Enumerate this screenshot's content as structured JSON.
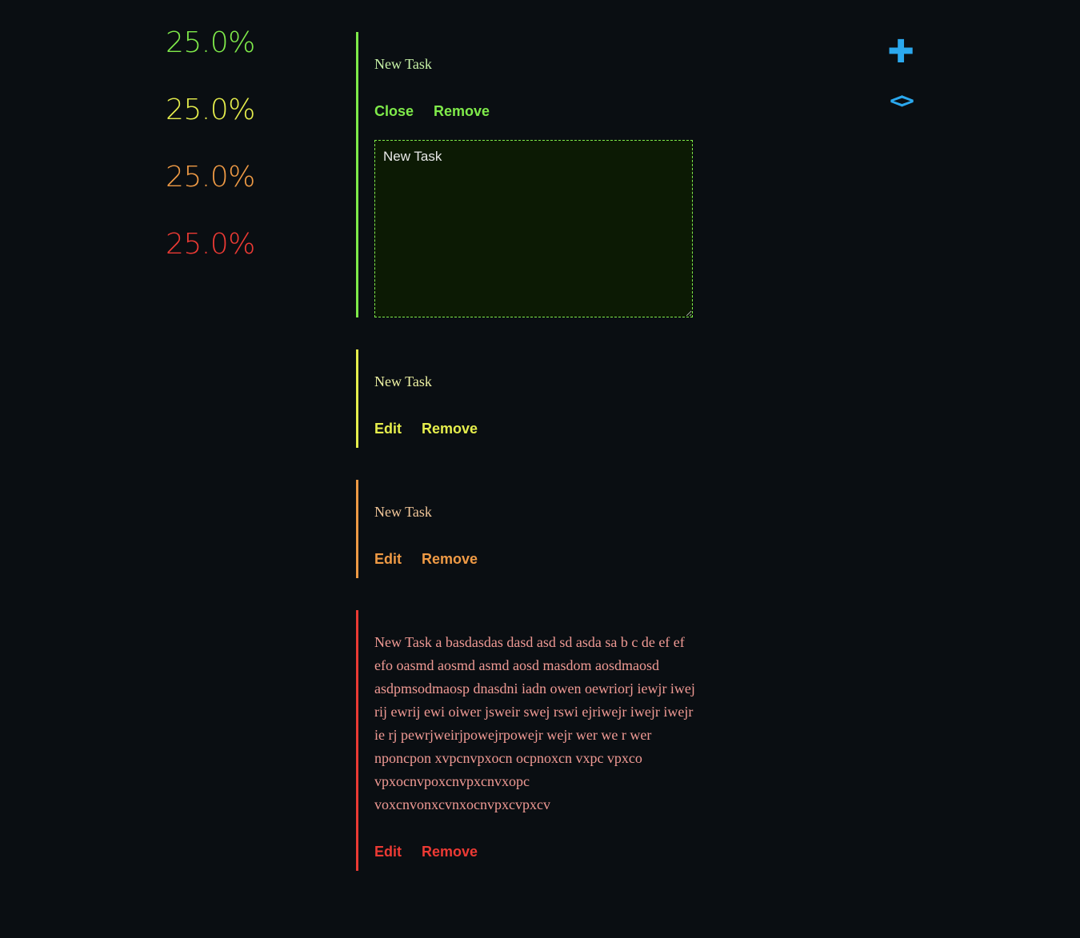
{
  "colors": {
    "background": "#0a0e12",
    "green": "#7fea4a",
    "yellow": "#e6ee4c",
    "orange": "#ef9a45",
    "red": "#ec3a34",
    "accent_blue": "#2ba8ee",
    "editor_bg": "#0c1a04"
  },
  "stats": [
    {
      "value": "25.0%",
      "color": "#7fea4a"
    },
    {
      "value": "25.0%",
      "color": "#e6ee4c"
    },
    {
      "value": "25.0%",
      "color": "#ef9a45"
    },
    {
      "value": "25.0%",
      "color": "#ec3a34"
    }
  ],
  "tasks": [
    {
      "text": "New Task",
      "border_color": "#7fea4a",
      "text_color": "#c8f3a8",
      "action_color": "#7fea4a",
      "editing": true,
      "primary_action": "Close",
      "secondary_action": "Remove",
      "editor_value": "New Task"
    },
    {
      "text": "New Task",
      "border_color": "#e6ee4c",
      "text_color": "#eef2a4",
      "action_color": "#e6ee4c",
      "primary_action": "Edit",
      "secondary_action": "Remove"
    },
    {
      "text": "New Task",
      "border_color": "#ef9a45",
      "text_color": "#f2c79a",
      "action_color": "#ef9a45",
      "primary_action": "Edit",
      "secondary_action": "Remove"
    },
    {
      "text": "New Task a basdasdas dasd asd sd asda sa b c de ef ef efo oasmd aosmd asmd aosd masdom aosdmaosd asdpmsodmaosp dnasdni iadn owen oewriorj iewjr iwej rij ewrij ewi oiwer jsweir swej rswi ejriwejr iwejr iwejr ie rj pewrjweirjpowejrpowejr wejr wer we r wer nponcpon xvpcnvpxocn ocpnoxcn vxpc vpxco vpxocnvpoxcnvpxcnvxopc voxcnvonxcvnxocnvpxcvpxcv",
      "border_color": "#ec3a34",
      "text_color": "#f09a94",
      "action_color": "#ec3a34",
      "primary_action": "Edit",
      "secondary_action": "Remove"
    }
  ],
  "toolbar": {
    "add_glyph": "✚",
    "add_icon": "plus-icon",
    "code_glyph": "<>",
    "code_icon": "code-icon"
  }
}
